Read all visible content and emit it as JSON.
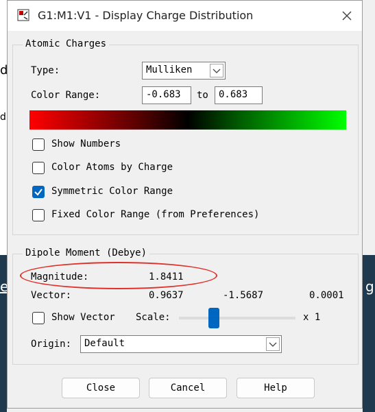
{
  "window": {
    "title": "G1:M1:V1 - Display Charge Distribution"
  },
  "atomic_charges": {
    "group_label": "Atomic Charges",
    "type_label": "Type:",
    "type_value": "Mulliken",
    "color_range_label": "Color Range:",
    "range_min": "-0.683",
    "range_to": "to",
    "range_max": "0.683",
    "gradient_colors": [
      "#ff0000",
      "#000000",
      "#00ff00"
    ],
    "checkboxes": [
      {
        "label": "Show Numbers",
        "checked": false
      },
      {
        "label": "Color Atoms by Charge",
        "checked": false
      },
      {
        "label": "Symmetric Color Range",
        "checked": true
      },
      {
        "label": "Fixed Color Range (from Preferences)",
        "checked": false
      }
    ]
  },
  "dipole": {
    "group_label": "Dipole Moment (Debye)",
    "magnitude_label": "Magnitude:",
    "magnitude_value": "1.8411",
    "vector_label": "Vector:",
    "vector": [
      "0.9637",
      "-1.5687",
      "0.0001"
    ],
    "show_vector_label": "Show Vector",
    "scale_label": "Scale:",
    "scale_suffix": "x 1",
    "scale_level": 0.3,
    "origin_label": "Origin:",
    "origin_value": "Default"
  },
  "buttons": {
    "close": "Close",
    "cancel": "Cancel",
    "help": "Help"
  },
  "background": {
    "frag1": "d",
    "frag2": "d",
    "frag3": "e",
    "frag4": "g"
  },
  "colors": {
    "accent": "#0067c0",
    "annotation": "#e0302a"
  }
}
